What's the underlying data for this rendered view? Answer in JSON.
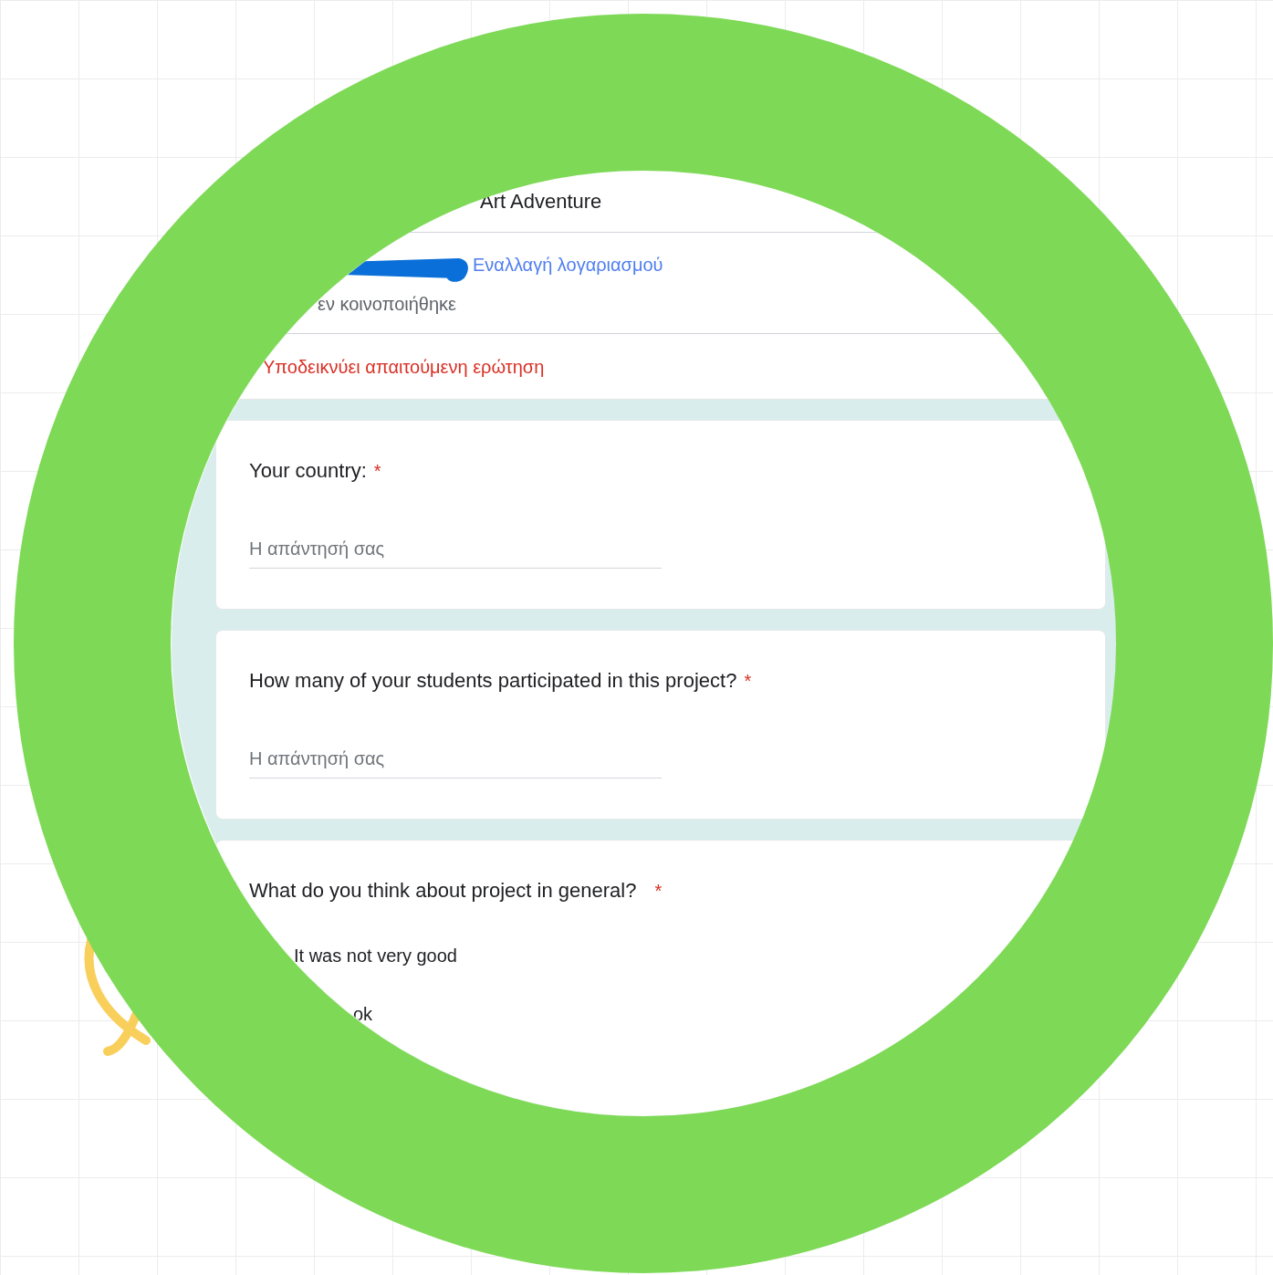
{
  "form": {
    "title": "Art Adventure",
    "switch_account_link": "Εναλλαγή λογαριασμού",
    "share_note": "εν κοινοποιήθηκε",
    "required_note": "Υποδεικνύει απαιτούμενη ερώτηση"
  },
  "questions": [
    {
      "kind": "text",
      "label": "Your country:",
      "required_mark": "*",
      "placeholder": "Η απάντησή σας"
    },
    {
      "kind": "text",
      "label": "How many of your students participated in this project?",
      "required_mark": "*",
      "placeholder": "Η απάντησή σας"
    },
    {
      "kind": "choice",
      "label": "What do you think about project in general?",
      "required_mark": "*",
      "options": [
        {
          "label": "It was not very good"
        },
        {
          "label": "ok"
        }
      ]
    }
  ]
}
